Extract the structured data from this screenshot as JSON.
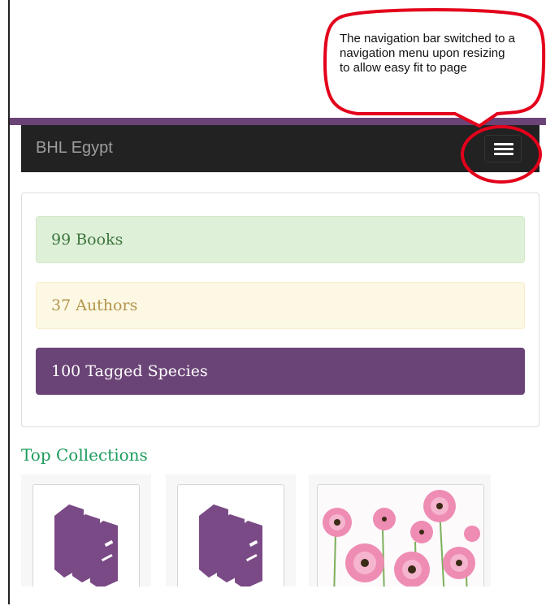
{
  "callout": {
    "text": "The navigation bar switched to a navigation menu upon resizing to allow easy fit to page"
  },
  "navbar": {
    "brand": "BHL Egypt",
    "toggle_icon": "hamburger-menu-icon"
  },
  "stats": {
    "books": "99 Books",
    "authors": "37 Authors",
    "species": "100 Tagged Species"
  },
  "collections": {
    "title": "Top Collections",
    "items": [
      {
        "icon": "books-icon"
      },
      {
        "icon": "books-icon"
      },
      {
        "icon": "flowers-photo"
      }
    ]
  },
  "colors": {
    "brand_purple": "#6b4477",
    "navbar_bg": "#222222",
    "callout_red": "#e3001b",
    "success_text": "#3c763d",
    "warning_text": "#b4954f",
    "section_green": "#1c9b5c"
  }
}
